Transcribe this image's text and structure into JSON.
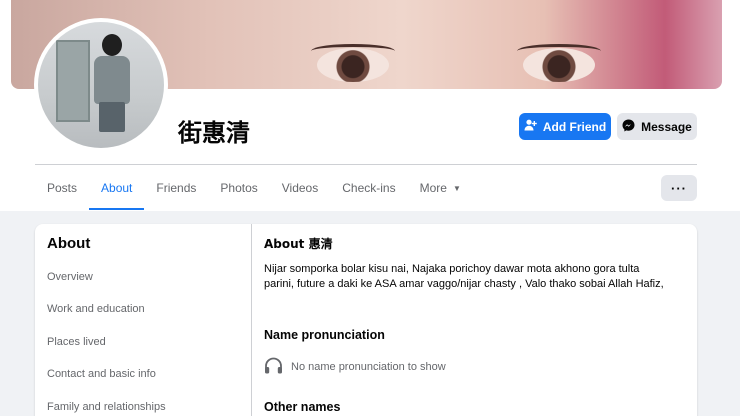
{
  "profile": {
    "name": "街惠清",
    "add_friend_label": "Add Friend",
    "message_label": "Message",
    "more_label": "···"
  },
  "tabs": [
    {
      "label": "Posts"
    },
    {
      "label": "About"
    },
    {
      "label": "Friends"
    },
    {
      "label": "Photos"
    },
    {
      "label": "Videos"
    },
    {
      "label": "Check-ins"
    },
    {
      "label": "More"
    }
  ],
  "sidebar": {
    "title": "About",
    "items": [
      {
        "label": "Overview"
      },
      {
        "label": "Work and education"
      },
      {
        "label": "Places lived"
      },
      {
        "label": "Contact and basic info"
      },
      {
        "label": "Family and relationships"
      }
    ]
  },
  "main": {
    "about_title": "About 惠清",
    "bio": "Nijar somporka bolar kisu nai, Najaka porichoy dawar mota akhono gora tulta parini, future a daki ke ASA amar vaggo/nijar chasty ,  Valo thako sobai Allah Hafiz,",
    "name_pronunciation_title": "Name pronunciation",
    "no_pronunciation_text": "No name pronunciation to show",
    "other_names_title": "Other names"
  },
  "colors": {
    "accent": "#1877f2",
    "page_bg": "#f0f2f5",
    "muted_text": "#65676b"
  }
}
